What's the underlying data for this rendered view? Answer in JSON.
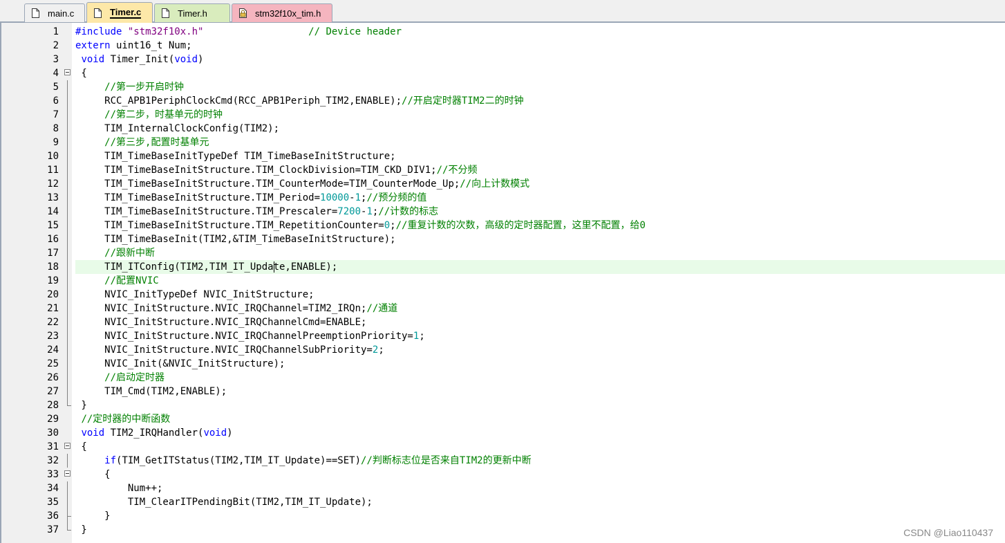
{
  "tabs": [
    {
      "label": "main.c",
      "icon": "c-file-icon",
      "color": "#f0f0f0",
      "active": false
    },
    {
      "label": "Timer.c",
      "icon": "c-file-icon",
      "color": "#fde8a8",
      "active": true
    },
    {
      "label": "Timer.h",
      "icon": "header-file-icon",
      "color": "#d9ecbd",
      "active": false
    },
    {
      "label": "stm32f10x_tim.h",
      "icon": "locked-header-file-icon",
      "color": "#f5b5bf",
      "active": false
    }
  ],
  "editor": {
    "current_line": 18,
    "lines": [
      {
        "n": "1",
        "fold": "",
        "segs": [
          {
            "t": "#include ",
            "c": "kw"
          },
          {
            "t": "\"stm32f10x.h\"",
            "c": "st"
          },
          {
            "t": "                  ",
            "c": ""
          },
          {
            "t": "// Device header",
            "c": "cm"
          }
        ]
      },
      {
        "n": "2",
        "fold": "",
        "segs": [
          {
            "t": "extern",
            "c": "kw"
          },
          {
            "t": " uint16_t Num;",
            "c": ""
          }
        ]
      },
      {
        "n": "3",
        "fold": "",
        "segs": [
          {
            "t": " ",
            "c": ""
          },
          {
            "t": "void",
            "c": "kw"
          },
          {
            "t": " Timer_Init(",
            "c": ""
          },
          {
            "t": "void",
            "c": "kw"
          },
          {
            "t": ")",
            "c": ""
          }
        ]
      },
      {
        "n": "4",
        "fold": "open",
        "segs": [
          {
            "t": " {",
            "c": ""
          }
        ]
      },
      {
        "n": "5",
        "fold": "mid",
        "segs": [
          {
            "t": "     ",
            "c": ""
          },
          {
            "t": "//第一步开启时钟",
            "c": "cm"
          }
        ]
      },
      {
        "n": "6",
        "fold": "mid",
        "segs": [
          {
            "t": "     RCC_APB1PeriphClockCmd(RCC_APB1Periph_TIM2,ENABLE);",
            "c": ""
          },
          {
            "t": "//开启定时器TIM2二的时钟",
            "c": "cm"
          }
        ]
      },
      {
        "n": "7",
        "fold": "mid",
        "segs": [
          {
            "t": "     ",
            "c": ""
          },
          {
            "t": "//第二步，时基单元的时钟",
            "c": "cm"
          }
        ]
      },
      {
        "n": "8",
        "fold": "mid",
        "segs": [
          {
            "t": "     TIM_InternalClockConfig(TIM2);",
            "c": ""
          }
        ]
      },
      {
        "n": "9",
        "fold": "mid",
        "segs": [
          {
            "t": "     ",
            "c": ""
          },
          {
            "t": "//第三步,配置时基单元",
            "c": "cm"
          }
        ]
      },
      {
        "n": "10",
        "fold": "mid",
        "segs": [
          {
            "t": "     TIM_TimeBaseInitTypeDef TIM_TimeBaseInitStructure;",
            "c": ""
          }
        ]
      },
      {
        "n": "11",
        "fold": "mid",
        "segs": [
          {
            "t": "     TIM_TimeBaseInitStructure.TIM_ClockDivision=TIM_CKD_DIV1;",
            "c": ""
          },
          {
            "t": "//不分频",
            "c": "cm"
          }
        ]
      },
      {
        "n": "12",
        "fold": "mid",
        "segs": [
          {
            "t": "     TIM_TimeBaseInitStructure.TIM_CounterMode=TIM_CounterMode_Up;",
            "c": ""
          },
          {
            "t": "//向上计数模式",
            "c": "cm"
          }
        ]
      },
      {
        "n": "13",
        "fold": "mid",
        "segs": [
          {
            "t": "     TIM_TimeBaseInitStructure.TIM_Period=",
            "c": ""
          },
          {
            "t": "10000",
            "c": "nm"
          },
          {
            "t": "-",
            "c": ""
          },
          {
            "t": "1",
            "c": "nm"
          },
          {
            "t": ";",
            "c": ""
          },
          {
            "t": "//预分频的值",
            "c": "cm"
          }
        ]
      },
      {
        "n": "14",
        "fold": "mid",
        "segs": [
          {
            "t": "     TIM_TimeBaseInitStructure.TIM_Prescaler=",
            "c": ""
          },
          {
            "t": "7200",
            "c": "nm"
          },
          {
            "t": "-",
            "c": ""
          },
          {
            "t": "1",
            "c": "nm"
          },
          {
            "t": ";",
            "c": ""
          },
          {
            "t": "//计数的标志",
            "c": "cm"
          }
        ]
      },
      {
        "n": "15",
        "fold": "mid",
        "segs": [
          {
            "t": "     TIM_TimeBaseInitStructure.TIM_RepetitionCounter=",
            "c": ""
          },
          {
            "t": "0",
            "c": "nm"
          },
          {
            "t": ";",
            "c": ""
          },
          {
            "t": "//重复计数的次数，高级的定时器配置，这里不配置，给0",
            "c": "cm"
          }
        ]
      },
      {
        "n": "16",
        "fold": "mid",
        "segs": [
          {
            "t": "     TIM_TimeBaseInit(TIM2,&TIM_TimeBaseInitStructure);",
            "c": ""
          }
        ]
      },
      {
        "n": "17",
        "fold": "mid",
        "segs": [
          {
            "t": "     ",
            "c": ""
          },
          {
            "t": "//跟新中断",
            "c": "cm"
          }
        ]
      },
      {
        "n": "18",
        "fold": "mid",
        "segs": [
          {
            "t": "     TIM_ITConfig(TIM2,TIM_IT_Upda",
            "c": ""
          },
          {
            "t": "",
            "c": "caret"
          },
          {
            "t": "te,ENABLE);",
            "c": ""
          }
        ]
      },
      {
        "n": "19",
        "fold": "mid",
        "segs": [
          {
            "t": "     ",
            "c": ""
          },
          {
            "t": "//配置NVIC",
            "c": "cm"
          }
        ]
      },
      {
        "n": "20",
        "fold": "mid",
        "segs": [
          {
            "t": "     NVIC_InitTypeDef NVIC_InitStructure;",
            "c": ""
          }
        ]
      },
      {
        "n": "21",
        "fold": "mid",
        "segs": [
          {
            "t": "     NVIC_InitStructure.NVIC_IRQChannel=TIM2_IRQn;",
            "c": ""
          },
          {
            "t": "//通道",
            "c": "cm"
          }
        ]
      },
      {
        "n": "22",
        "fold": "mid",
        "segs": [
          {
            "t": "     NVIC_InitStructure.NVIC_IRQChannelCmd=ENABLE;",
            "c": ""
          }
        ]
      },
      {
        "n": "23",
        "fold": "mid",
        "segs": [
          {
            "t": "     NVIC_InitStructure.NVIC_IRQChannelPreemptionPriority=",
            "c": ""
          },
          {
            "t": "1",
            "c": "nm"
          },
          {
            "t": ";",
            "c": ""
          }
        ]
      },
      {
        "n": "24",
        "fold": "mid",
        "segs": [
          {
            "t": "     NVIC_InitStructure.NVIC_IRQChannelSubPriority=",
            "c": ""
          },
          {
            "t": "2",
            "c": "nm"
          },
          {
            "t": ";",
            "c": ""
          }
        ]
      },
      {
        "n": "25",
        "fold": "mid",
        "segs": [
          {
            "t": "     NVIC_Init(&NVIC_InitStructure);",
            "c": ""
          }
        ]
      },
      {
        "n": "26",
        "fold": "mid",
        "segs": [
          {
            "t": "     ",
            "c": ""
          },
          {
            "t": "//启动定时器",
            "c": "cm"
          }
        ]
      },
      {
        "n": "27",
        "fold": "mid",
        "segs": [
          {
            "t": "     TIM_Cmd(TIM2,ENABLE);",
            "c": ""
          }
        ]
      },
      {
        "n": "28",
        "fold": "end",
        "segs": [
          {
            "t": " }",
            "c": ""
          }
        ]
      },
      {
        "n": "29",
        "fold": "",
        "segs": [
          {
            "t": " ",
            "c": ""
          },
          {
            "t": "//定时器的中断函数",
            "c": "cm"
          }
        ]
      },
      {
        "n": "30",
        "fold": "",
        "segs": [
          {
            "t": " ",
            "c": ""
          },
          {
            "t": "void",
            "c": "kw"
          },
          {
            "t": " TIM2_IRQHandler(",
            "c": ""
          },
          {
            "t": "void",
            "c": "kw"
          },
          {
            "t": ")",
            "c": ""
          }
        ]
      },
      {
        "n": "31",
        "fold": "open",
        "segs": [
          {
            "t": " {",
            "c": ""
          }
        ]
      },
      {
        "n": "32",
        "fold": "mid",
        "segs": [
          {
            "t": "     ",
            "c": ""
          },
          {
            "t": "if",
            "c": "kw"
          },
          {
            "t": "(TIM_GetITStatus(TIM2,TIM_IT_Update)==SET)",
            "c": ""
          },
          {
            "t": "//判断标志位是否来自TIM2的更新中断",
            "c": "cm"
          }
        ]
      },
      {
        "n": "33",
        "fold": "open",
        "segs": [
          {
            "t": "     {",
            "c": ""
          }
        ]
      },
      {
        "n": "34",
        "fold": "mid",
        "segs": [
          {
            "t": "         Num++;",
            "c": ""
          }
        ]
      },
      {
        "n": "35",
        "fold": "mid",
        "segs": [
          {
            "t": "         TIM_ClearITPendingBit(TIM2,TIM_IT_Update);",
            "c": ""
          }
        ]
      },
      {
        "n": "36",
        "fold": "endmid",
        "segs": [
          {
            "t": "     }",
            "c": ""
          }
        ]
      },
      {
        "n": "37",
        "fold": "end",
        "segs": [
          {
            "t": " }",
            "c": ""
          }
        ]
      }
    ]
  },
  "watermark": "CSDN @Liao110437"
}
